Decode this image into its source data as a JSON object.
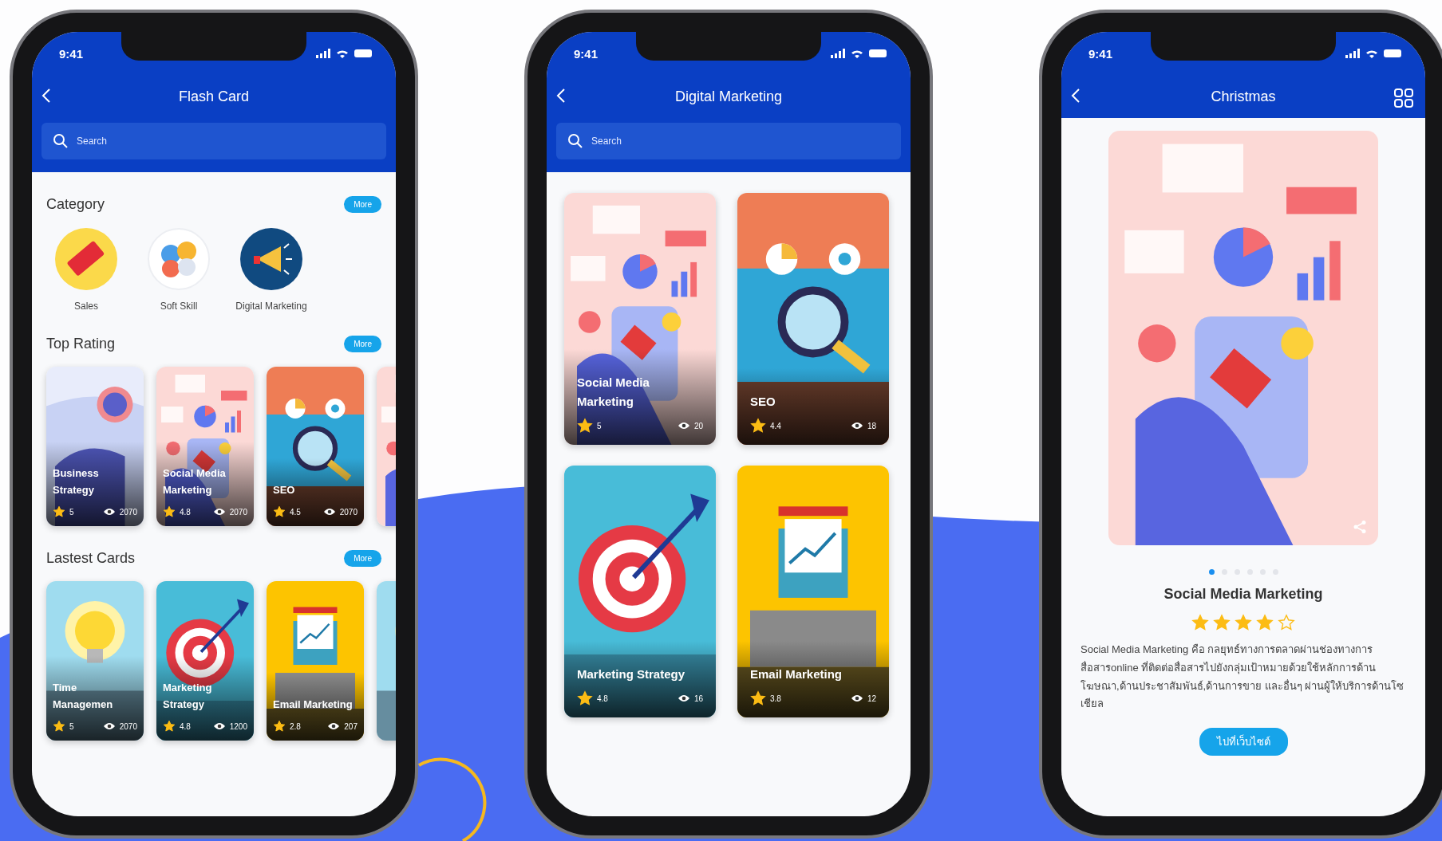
{
  "phones": [
    {
      "kind": "home",
      "status_time": "9:41",
      "title": "Flash Card",
      "search": {
        "placeholder": "Search"
      },
      "sections": [
        {
          "kind": "category",
          "heading": "Category",
          "more": "More",
          "items": [
            {
              "label": "Sales",
              "kind": "sale"
            },
            {
              "label": "Soft Skill",
              "kind": "puzzle"
            },
            {
              "label": "Digital Marketing",
              "kind": "megaphone"
            }
          ]
        },
        {
          "kind": "cards",
          "heading": "Top Rating",
          "more": "More",
          "cards": [
            {
              "title": "Business Strategy",
              "kind": "strategy",
              "rating": "5",
              "views": "2070"
            },
            {
              "title": "Social Media Marketing",
              "kind": "social",
              "rating": "4.8",
              "views": "2070"
            },
            {
              "title": "SEO",
              "kind": "seo",
              "rating": "4.5",
              "views": "2070"
            },
            {
              "kind": "social"
            }
          ]
        },
        {
          "kind": "cards",
          "heading": "Lastest Cards",
          "more": "More",
          "cards": [
            {
              "title": "Time Managemen",
              "kind": "bulb",
              "rating": "5",
              "views": "2070"
            },
            {
              "title": "Marketing Strategy",
              "kind": "target",
              "rating": "4.8",
              "views": "1200"
            },
            {
              "title": "Email Marketing",
              "kind": "email",
              "rating": "2.8",
              "views": "207"
            },
            {
              "kind": "bulb"
            }
          ]
        }
      ]
    },
    {
      "kind": "list",
      "status_time": "9:41",
      "title": "Digital Marketing",
      "search": {
        "placeholder": "Search"
      },
      "cards": [
        {
          "title": "Social Media Marketing",
          "kind": "social",
          "rating": "5",
          "views": "20"
        },
        {
          "title": "SEO",
          "kind": "seo",
          "rating": "4.4",
          "views": "18"
        },
        {
          "title": "Marketing Strategy",
          "kind": "target",
          "rating": "4.8",
          "views": "16"
        },
        {
          "title": "Email Marketing",
          "kind": "email",
          "rating": "3.8",
          "views": "12"
        }
      ]
    },
    {
      "kind": "detail",
      "status_time": "9:41",
      "title": "Christmas",
      "image": {
        "kind": "social"
      },
      "pages": [
        {
          "selected": true
        },
        {
          "selected": false
        },
        {
          "selected": false
        },
        {
          "selected": false
        },
        {
          "selected": false
        },
        {
          "selected": false
        }
      ],
      "card_title": "Social Media Marketing",
      "stars": 4,
      "description": "Social Media Marketing คือ กลยุทธ์ทางการตลาดผ่านช่องทางการสื่อสารonline ที่ติดต่อสื่อสารไปยังกลุ่มเป้าหมายด้วยใช้หลักการด้านโฆษณา,ด้านประชาสัมพันธ์,ด้านการขาย และอื่นๆ ผ่านผู้ให้บริการด้านโซเชียล",
      "button": "ไปที่เว็บไซต์"
    }
  ]
}
